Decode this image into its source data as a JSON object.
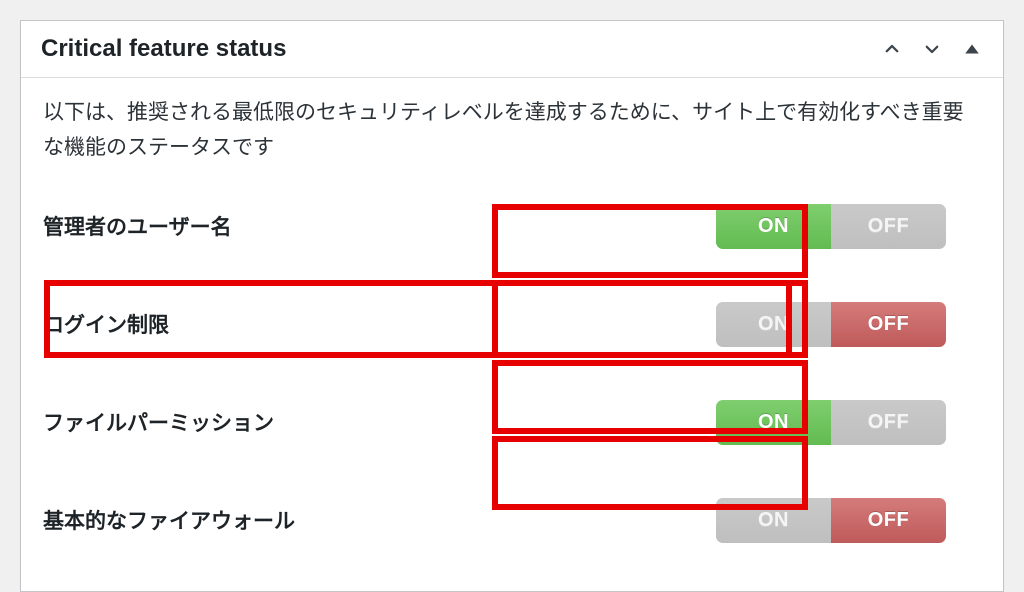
{
  "panel": {
    "title": "Critical feature status",
    "description": "以下は、推奨される最低限のセキュリティレベルを達成するために、サイト上で有効化すべき重要な機能のステータスです"
  },
  "toggle_labels": {
    "on": "ON",
    "off": "OFF"
  },
  "features": [
    {
      "label": "管理者のユーザー名",
      "state": "on"
    },
    {
      "label": "ログイン制限",
      "state": "off"
    },
    {
      "label": "ファイルパーミッション",
      "state": "on"
    },
    {
      "label": "基本的なファイアウォール",
      "state": "off"
    }
  ],
  "highlights": {
    "toggle_column": true,
    "row_index": 1
  }
}
